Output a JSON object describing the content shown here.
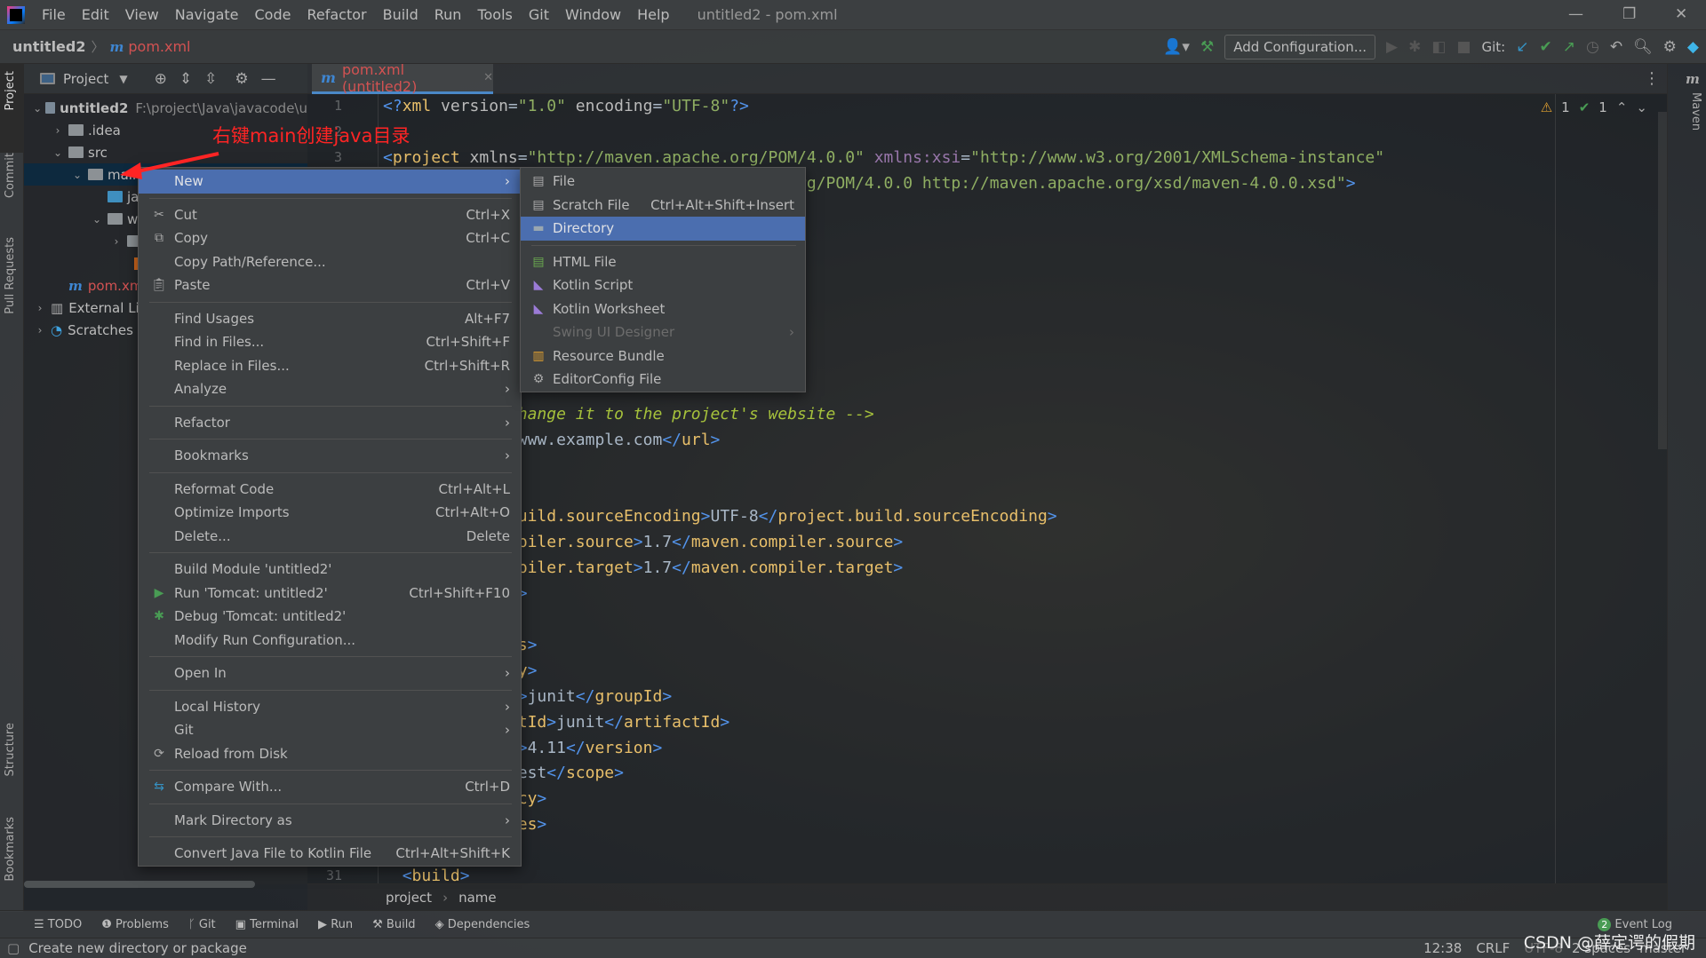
{
  "window": {
    "title": "untitled2 - pom.xml"
  },
  "menu": [
    "File",
    "Edit",
    "View",
    "Navigate",
    "Code",
    "Refactor",
    "Build",
    "Run",
    "Tools",
    "Git",
    "Window",
    "Help"
  ],
  "nav": {
    "project": "untitled2",
    "file": "pom.xml",
    "file_icon": "m"
  },
  "toolbar": {
    "add_config": "Add Configuration...",
    "git_label": "Git:"
  },
  "stripe_left": [
    "Project",
    "Commit",
    "Pull Requests",
    "Structure",
    "Bookmarks"
  ],
  "stripe_right": [
    "Maven"
  ],
  "project_panel": {
    "title": "Project"
  },
  "tree": [
    {
      "name": "untitled2",
      "path": "F:\\project\\Java\\javacode\\u",
      "level": 0,
      "expanded": true
    },
    {
      "name": ".idea",
      "level": 1,
      "expanded": false
    },
    {
      "name": "src",
      "level": 1,
      "expanded": true
    },
    {
      "name": "main",
      "level": 2,
      "expanded": true,
      "selected": true
    },
    {
      "name": "java",
      "level": 3
    },
    {
      "name": "webapp",
      "level": 3,
      "expanded": true
    },
    {
      "name": "pom.xml",
      "level": 1
    },
    {
      "name": "External Libraries",
      "level": 0
    },
    {
      "name": "Scratches and Consoles",
      "level": 0
    }
  ],
  "annotation": "右键main创建java目录",
  "editor": {
    "tab": "pom.xml (untitled2)",
    "inspections": {
      "warnings": "1",
      "ok": "1"
    },
    "lines": [
      "<?xml version=\"1.0\" encoding=\"UTF-8\"?>",
      "",
      "<project xmlns=\"http://maven.apache.org/POM/4.0.0\" xmlns:xsi=\"http://www.w3.org/2001/XMLSchema-instance\"",
      "  xsi:schemaLocation=\"http://maven.apache.org/POM/4.0.0 http://maven.apache.org/xsd/maven-4.0.0.xsd\">",
      "",
      "",
      "",
      "",
      "",
      "",
      "",
      "",
      "  <!-- FIXME change it to the project's website -->",
      "  <url>http://www.example.com</url>",
      "",
      "",
      "    <project.build.sourceEncoding>UTF-8</project.build.sourceEncoding>",
      "    <maven.compiler.source>1.7</maven.compiler.source>",
      "    <maven.compiler.target>1.7</maven.compiler.target>",
      "  </properties>",
      "",
      "  <dependencies>",
      "    <dependency>",
      "      <groupId>junit</groupId>",
      "      <artifactId>junit</artifactId>",
      "      <version>4.11</version>",
      "      <scope>test</scope>",
      "    </dependency>",
      "  </dependencies>",
      "",
      "  <build>"
    ],
    "visible_line_numbers": [
      "1",
      "2",
      "3",
      "31"
    ],
    "breadcrumb": [
      "project",
      "name"
    ]
  },
  "context_menu": [
    {
      "label": "New",
      "submenu": true,
      "active": true
    },
    {
      "sep": true
    },
    {
      "label": "Cut",
      "shortcut": "Ctrl+X",
      "icon": "scissors-icon"
    },
    {
      "label": "Copy",
      "shortcut": "Ctrl+C",
      "icon": "copy-icon"
    },
    {
      "label": "Copy Path/Reference..."
    },
    {
      "label": "Paste",
      "shortcut": "Ctrl+V",
      "icon": "clipboard-icon"
    },
    {
      "sep": true
    },
    {
      "label": "Find Usages",
      "shortcut": "Alt+F7"
    },
    {
      "label": "Find in Files...",
      "shortcut": "Ctrl+Shift+F"
    },
    {
      "label": "Replace in Files...",
      "shortcut": "Ctrl+Shift+R"
    },
    {
      "label": "Analyze",
      "submenu": true
    },
    {
      "sep": true
    },
    {
      "label": "Refactor",
      "submenu": true
    },
    {
      "sep": true
    },
    {
      "label": "Bookmarks",
      "submenu": true
    },
    {
      "sep": true
    },
    {
      "label": "Reformat Code",
      "shortcut": "Ctrl+Alt+L"
    },
    {
      "label": "Optimize Imports",
      "shortcut": "Ctrl+Alt+O"
    },
    {
      "label": "Delete...",
      "shortcut": "Delete"
    },
    {
      "sep": true
    },
    {
      "label": "Build Module 'untitled2'"
    },
    {
      "label": "Run 'Tomcat: untitled2'",
      "shortcut": "Ctrl+Shift+F10",
      "icon": "run-icon"
    },
    {
      "label": "Debug 'Tomcat: untitled2'",
      "icon": "debug-icon"
    },
    {
      "label": "Modify Run Configuration..."
    },
    {
      "sep": true
    },
    {
      "label": "Open In",
      "submenu": true
    },
    {
      "sep": true
    },
    {
      "label": "Local History",
      "submenu": true
    },
    {
      "label": "Git",
      "submenu": true
    },
    {
      "label": "Reload from Disk",
      "icon": "reload-icon"
    },
    {
      "sep": true
    },
    {
      "label": "Compare With...",
      "shortcut": "Ctrl+D",
      "icon": "compare-icon"
    },
    {
      "sep": true
    },
    {
      "label": "Mark Directory as",
      "submenu": true
    },
    {
      "sep": true
    },
    {
      "label": "Convert Java File to Kotlin File",
      "shortcut": "Ctrl+Alt+Shift+K"
    }
  ],
  "new_submenu": [
    {
      "label": "File",
      "icon": "file-icon"
    },
    {
      "label": "Scratch File",
      "shortcut": "Ctrl+Alt+Shift+Insert",
      "icon": "scratch-file-icon"
    },
    {
      "label": "Directory",
      "icon": "folder-icon",
      "active": true
    },
    {
      "sep": true
    },
    {
      "label": "HTML File",
      "icon": "html-file-icon"
    },
    {
      "label": "Kotlin Script",
      "icon": "kotlin-icon"
    },
    {
      "label": "Kotlin Worksheet",
      "icon": "kotlin-icon"
    },
    {
      "label": "Swing UI Designer",
      "submenu": true,
      "disabled": true
    },
    {
      "label": "Resource Bundle",
      "icon": "resource-bundle-icon"
    },
    {
      "label": "EditorConfig File",
      "icon": "gear-icon"
    }
  ],
  "tool_tabs": [
    "TODO",
    "Problems",
    "Git",
    "Terminal",
    "Run",
    "Build",
    "Dependencies"
  ],
  "event_log": {
    "label": "Event Log",
    "count": "2"
  },
  "status": {
    "message": "Create new directory or package",
    "position": "12:38",
    "line_sep": "CRLF",
    "encoding": "UTF-8",
    "indent": "2 spaces",
    "branch": "master",
    "watermark": "CSDN @薛定谔的假期"
  }
}
